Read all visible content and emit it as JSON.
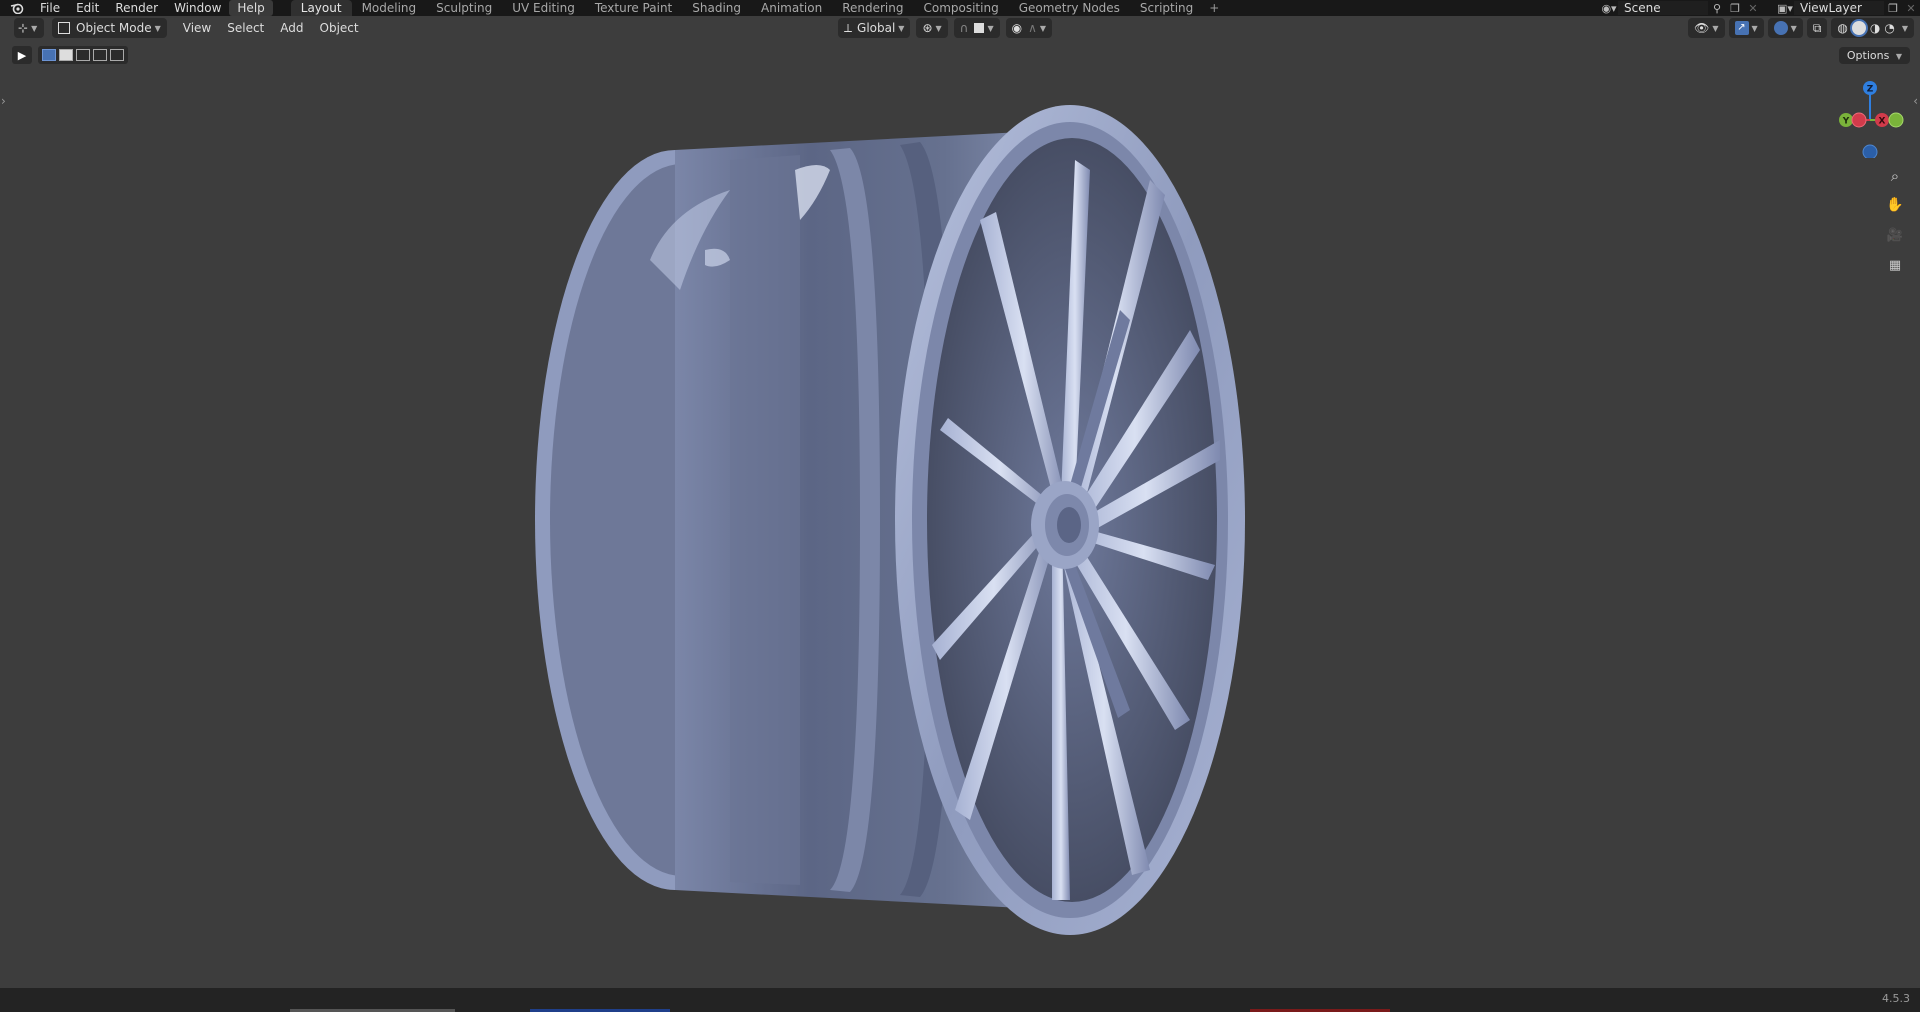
{
  "menu": {
    "file": "File",
    "edit": "Edit",
    "render": "Render",
    "window": "Window",
    "help": "Help"
  },
  "workspaces": [
    "Layout",
    "Modeling",
    "Sculpting",
    "UV Editing",
    "Texture Paint",
    "Shading",
    "Animation",
    "Rendering",
    "Compositing",
    "Geometry Nodes",
    "Scripting"
  ],
  "active_workspace": "Layout",
  "scene": {
    "name": "Scene"
  },
  "view_layer": {
    "name": "ViewLayer"
  },
  "viewport_header": {
    "mode": "Object Mode",
    "menus": {
      "view": "View",
      "select": "Select",
      "add": "Add",
      "object": "Object"
    },
    "transform_orientation": "Global",
    "options": "Options"
  },
  "gizmo": {
    "z": "Z",
    "y": "Y",
    "x": "X"
  },
  "status": {
    "version": "4.5.3"
  },
  "colors": {
    "accent": "#4772b3",
    "axis_x": "#d23b4b",
    "axis_y": "#7ab33a",
    "axis_z": "#2f7fe0",
    "wheel": "#8f9bbe"
  }
}
